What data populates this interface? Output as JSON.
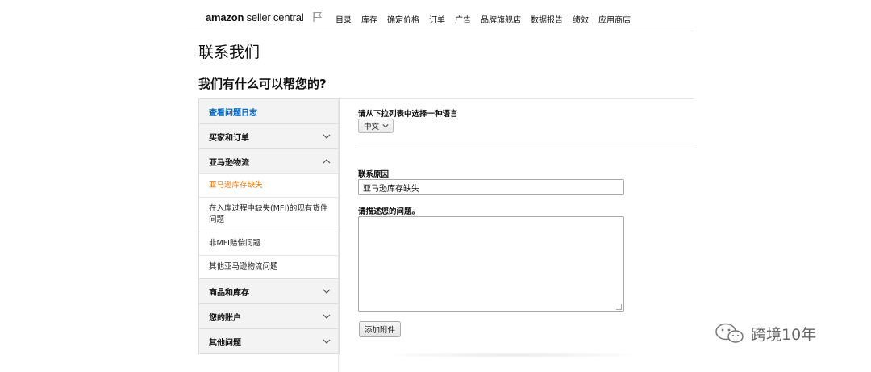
{
  "header": {
    "logo_bold": "amazon",
    "logo_light": " seller central",
    "nav": [
      "目录",
      "库存",
      "确定价格",
      "订单",
      "广告",
      "品牌旗舰店",
      "数据报告",
      "绩效",
      "应用商店"
    ]
  },
  "page": {
    "title": "联系我们",
    "subtitle": "我们有什么可以帮您的?"
  },
  "sidebar": {
    "case_log": "查看问题日志",
    "buyers_orders": "买家和订单",
    "fba": "亚马逊物流",
    "fba_items": [
      "亚马逊库存缺失",
      "在入库过程中缺失(MFI)的现有货件问题",
      "非MFI赔偿问题",
      "其他亚马逊物流问题"
    ],
    "products_inventory": "商品和库存",
    "your_account": "您的账户",
    "other_issues": "其他问题"
  },
  "form": {
    "language_label": "请从下拉列表中选择一种语言",
    "language_value": "中文",
    "reason_label": "联系原因",
    "reason_value": "亚马逊库存缺失",
    "describe_label": "请描述您的问题。",
    "attach_button": "添加附件"
  },
  "watermark": {
    "text": "跨境10年"
  }
}
